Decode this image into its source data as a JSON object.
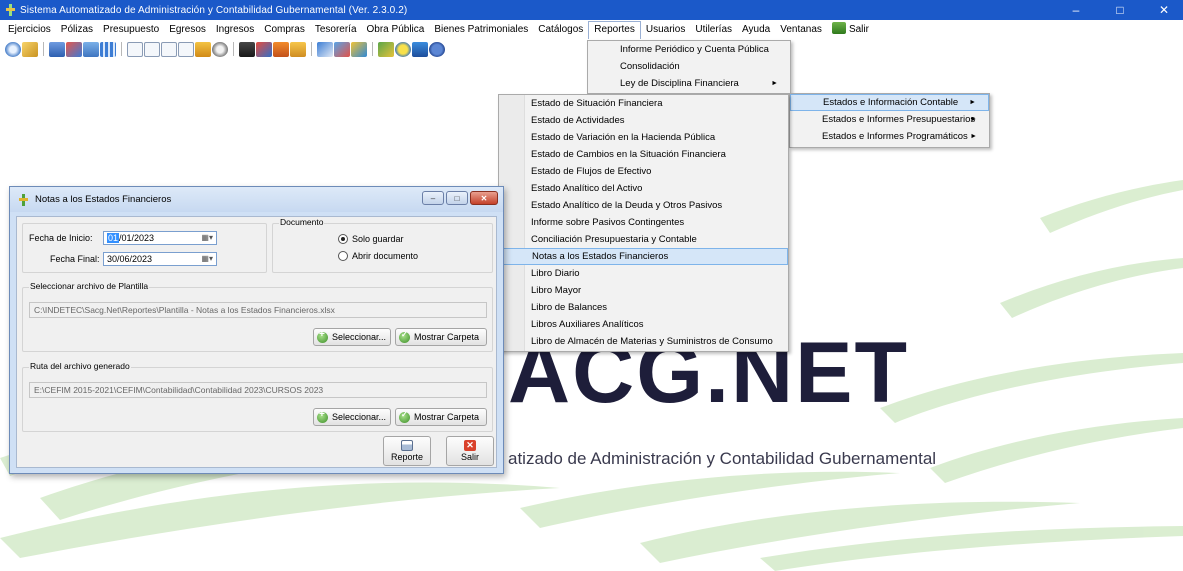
{
  "window": {
    "title": "Sistema Automatizado de Administración y Contabilidad Gubernamental  (Ver. 2.3.0.2)",
    "minimize": "–",
    "maximize": "□",
    "close": "✕"
  },
  "menubar": {
    "items": [
      "Ejercicios",
      "Pólizas",
      "Presupuesto",
      "Egresos",
      "Ingresos",
      "Compras",
      "Tesorería",
      "Obra Pública",
      "Bienes Patrimoniales",
      "Catálogos",
      "Reportes",
      "Usuarios",
      "Utilerías",
      "Ayuda",
      "Ventanas",
      "Salir"
    ],
    "active": "Reportes"
  },
  "reportes_menu": {
    "items": [
      "Informe Periódico y Cuenta Pública",
      "Consolidación",
      "Ley de Disciplina Financiera"
    ],
    "submenu_arrow": "►"
  },
  "estados_submenu": {
    "items": [
      "Estados e Información Contable",
      "Estados e Informes Presupuestarios",
      "Estados e Informes Programáticos"
    ]
  },
  "contable_submenu": {
    "items": [
      "Estado de Situación Financiera",
      "Estado de Actividades",
      "Estado de Variación en la Hacienda Pública",
      "Estado de Cambios en la Situación Financiera",
      "Estado de Flujos de Efectivo",
      "Estado Analítico del Activo",
      "Estado Analítico de la Deuda y Otros Pasivos",
      "Informe sobre Pasivos Contingentes",
      "Conciliación Presupuestaria y Contable",
      "Notas a los Estados Financieros",
      "Libro Diario",
      "Libro Mayor",
      "Libro de Balances",
      "Libros Auxiliares Analíticos",
      "Libro de Almacén de Materias y Suministros de Consumo"
    ],
    "highlighted": "Notas a los Estados Financieros"
  },
  "background": {
    "logo_text": "ACG.NET",
    "logo_subtitle": "atizado de Administración y Contabilidad Gubernamental"
  },
  "dialog": {
    "title": "Notas a los Estados Financieros",
    "fecha_inicio_label": "Fecha de Inicio:",
    "fecha_inicio_sel": "01",
    "fecha_inicio_rest": "/01/2023",
    "fecha_final_label": "Fecha Final:",
    "fecha_final": "30/06/2023",
    "documento_label": "Documento",
    "radio_solo_guardar": "Solo guardar",
    "radio_abrir": "Abrir documento",
    "plantilla_label": "Seleccionar archivo de Plantilla",
    "plantilla_path": "C:\\INDETEC\\Sacg.Net\\Reportes\\Plantilla - Notas a los Estados Financieros.xlsx",
    "ruta_label": "Ruta del archivo generado",
    "ruta_path": "E:\\CEFIM 2015-2021\\CEFIM\\Contabilidad\\Contabilidad 2023\\CURSOS 2023",
    "seleccionar": "Seleccionar...",
    "mostrar_carpeta": "Mostrar Carpeta",
    "reporte": "Reporte",
    "salir": "Salir"
  }
}
